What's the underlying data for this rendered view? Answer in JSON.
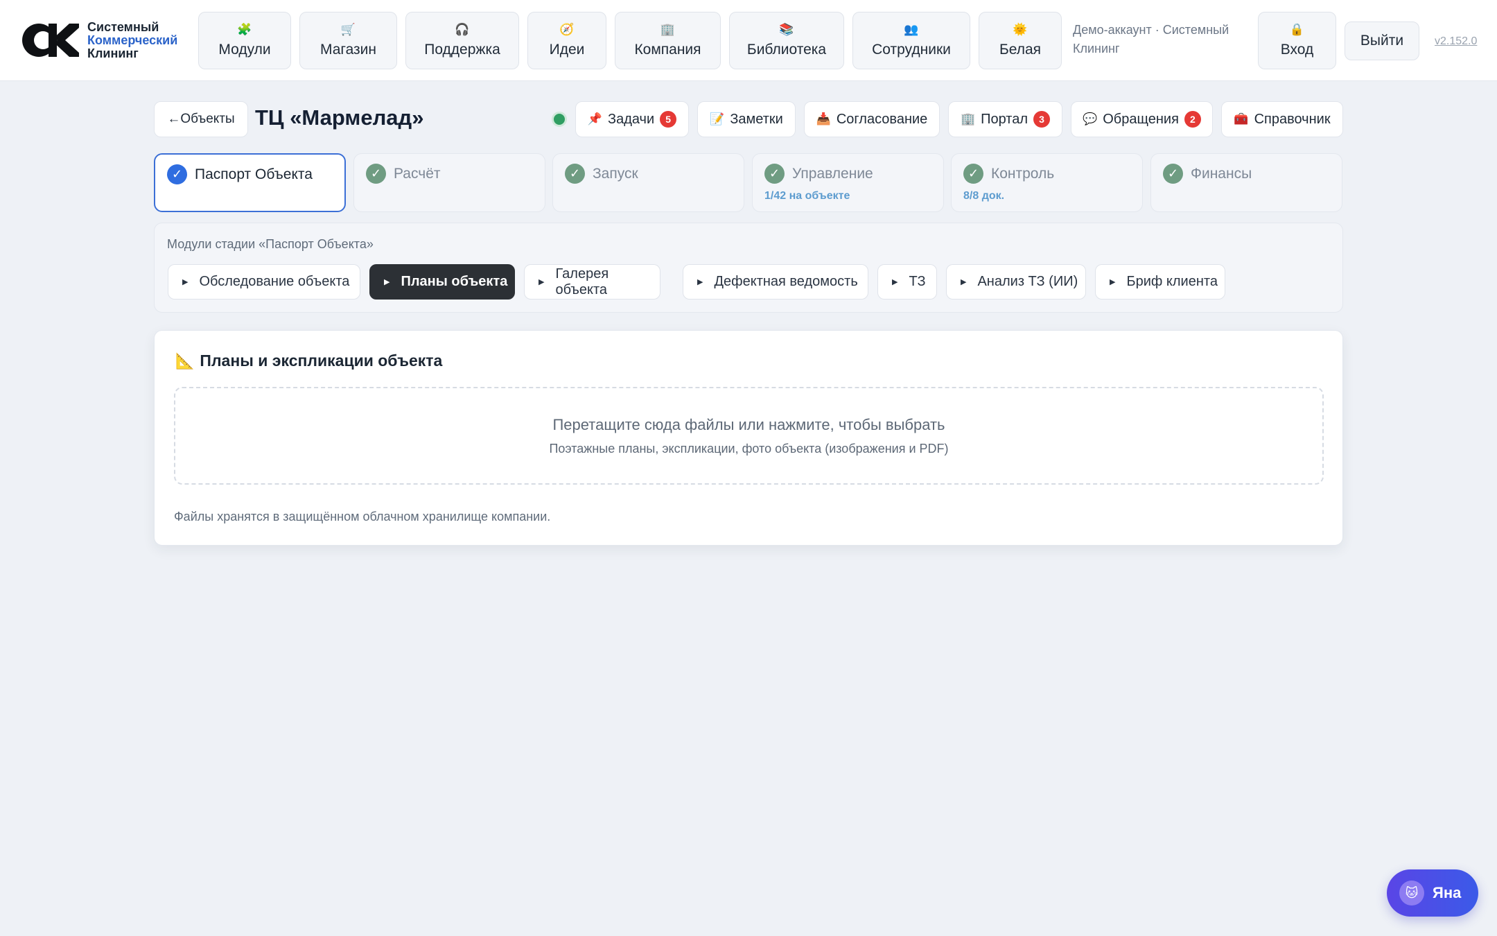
{
  "brand": {
    "line1": "Системный",
    "line2": "Коммерческий",
    "line3": "Клининг"
  },
  "nav": [
    {
      "label": "Модули",
      "icon": "puzzle-icon",
      "glyph": "🧩"
    },
    {
      "label": "Магазин",
      "icon": "cart-icon",
      "glyph": "🛒"
    },
    {
      "label": "Поддержка",
      "icon": "headphones-icon",
      "glyph": "🎧"
    },
    {
      "label": "Идеи",
      "icon": "compass-icon",
      "glyph": "🧭"
    },
    {
      "label": "Компания",
      "icon": "building-icon",
      "glyph": "🏢"
    },
    {
      "label": "Библиотека",
      "icon": "books-icon",
      "glyph": "📚"
    },
    {
      "label": "Сотрудники",
      "icon": "people-icon",
      "glyph": "👥"
    },
    {
      "label": "Белая",
      "icon": "sun-icon",
      "glyph": "🌞"
    }
  ],
  "account": {
    "demo_text": "Демо-аккаунт · Системный Клининг",
    "login_label": "Вход",
    "login_glyph": "🔒",
    "logout_label": "Выйти",
    "version": "v2.152.0"
  },
  "header": {
    "back_label": "←Объекты",
    "title": "ТЦ «Мармелад»",
    "status_color": "#2f9e62",
    "buttons": [
      {
        "label": "Задачи",
        "icon": "pin-icon",
        "glyph": "📌",
        "badge": "5"
      },
      {
        "label": "Заметки",
        "icon": "memo-icon",
        "glyph": "📝",
        "badge": null
      },
      {
        "label": "Согласование",
        "icon": "inbox-icon",
        "glyph": "📥",
        "badge": null
      },
      {
        "label": "Портал",
        "icon": "building-icon",
        "glyph": "🏢",
        "badge": "3"
      },
      {
        "label": "Обращения",
        "icon": "speech-bubble-icon",
        "glyph": "💬",
        "badge": "2"
      },
      {
        "label": "Справочник",
        "icon": "toolbox-icon",
        "glyph": "🧰",
        "badge": null
      }
    ]
  },
  "stages": [
    {
      "label": "Паспорт Объекта",
      "sub": "",
      "active": true
    },
    {
      "label": "Расчёт",
      "sub": "",
      "active": false
    },
    {
      "label": "Запуск",
      "sub": "",
      "active": false
    },
    {
      "label": "Управление",
      "sub": "1/42 на объекте",
      "active": false
    },
    {
      "label": "Контроль",
      "sub": "8/8 док.",
      "active": false
    },
    {
      "label": "Финансы",
      "sub": "",
      "active": false
    }
  ],
  "modules": {
    "title": "Модули стадии «Паспорт Объекта»",
    "items": [
      {
        "label": "Обследование объекта",
        "active": false
      },
      {
        "label": "Планы объекта",
        "active": true
      },
      {
        "label": "Галерея объекта",
        "active": false
      },
      {
        "label": "Дефектная ведомость",
        "active": false
      },
      {
        "label": "ТЗ",
        "active": false
      },
      {
        "label": "Анализ ТЗ (ИИ)",
        "active": false
      },
      {
        "label": "Бриф клиента",
        "active": false
      }
    ]
  },
  "card": {
    "title": "Планы и экспликации объекта",
    "title_glyph": "📐",
    "dropzone_main": "Перетащите сюда файлы или нажмите, чтобы выбрать",
    "dropzone_sub": "Поэтажные планы, экспликации, фото объекта (изображения и PDF)",
    "note": "Файлы хранятся в защищённом облачном хранилище компании."
  },
  "assistant": {
    "name": "Яна",
    "glyph": "🐱"
  },
  "colors": {
    "accent": "#2f6de0",
    "badge": "#e53935",
    "done_check": "#6f9c82",
    "sub_text": "#5d9ccf"
  }
}
